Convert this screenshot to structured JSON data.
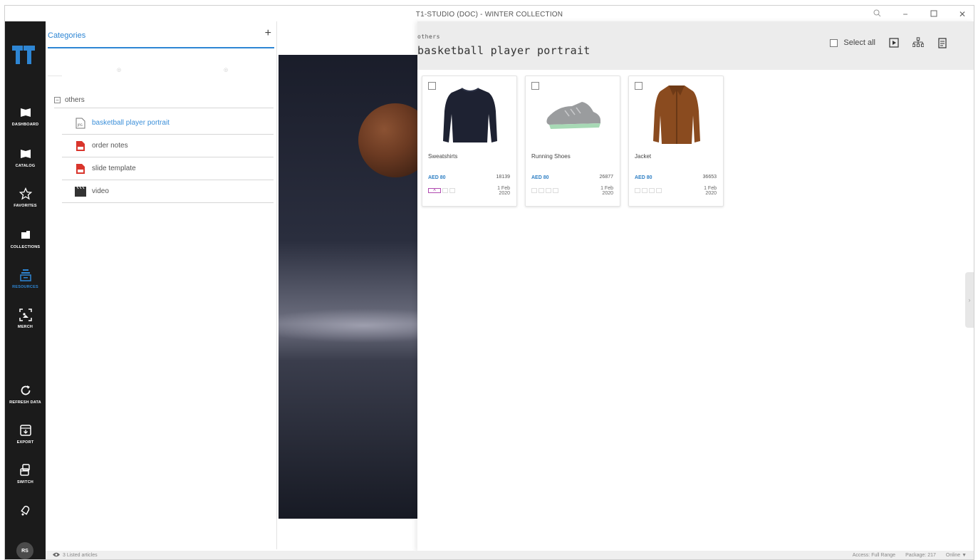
{
  "window": {
    "title": "T1-STUDIO (DOC) - WINTER COLLECTION"
  },
  "nav": {
    "items": [
      {
        "label": "DASHBOARD",
        "icon": "dashboard-icon"
      },
      {
        "label": "CATALOG",
        "icon": "catalog-icon"
      },
      {
        "label": "FAVORITES",
        "icon": "star-icon"
      },
      {
        "label": "COLLECTIONS",
        "icon": "collections-icon"
      },
      {
        "label": "RESOURCES",
        "icon": "resources-icon",
        "active": true
      },
      {
        "label": "MERCH",
        "icon": "merch-icon"
      },
      {
        "label": "REFRESH DATA",
        "icon": "refresh-icon"
      },
      {
        "label": "EXPORT",
        "icon": "export-icon"
      },
      {
        "label": "SWITCH",
        "icon": "switch-icon"
      },
      {
        "label": "",
        "icon": "notification-icon"
      }
    ],
    "avatar": "RS"
  },
  "categories": {
    "title": "Categories",
    "add": "+",
    "tree": {
      "root": "others",
      "items": [
        {
          "label": "basketball player portrait",
          "icon": "jpg-file-icon",
          "selected": true
        },
        {
          "label": "order notes",
          "icon": "pdf-file-icon"
        },
        {
          "label": "slide template",
          "icon": "pdf-file-icon"
        },
        {
          "label": "video",
          "icon": "video-icon"
        }
      ]
    }
  },
  "resource": {
    "breadcrumb": "others",
    "title": "basketball player portrait",
    "select_all": "Select all"
  },
  "articles": [
    {
      "name": "Sweatshirts",
      "price": "AED 80",
      "code": "18139",
      "tag": "A",
      "date_day": "1 Feb",
      "date_year": "2020"
    },
    {
      "name": "Running Shoes",
      "price": "AED 80",
      "code": "26877",
      "tag": "",
      "date_day": "1 Feb",
      "date_year": "2020"
    },
    {
      "name": "Jacket",
      "price": "AED 80",
      "code": "36653",
      "tag": "",
      "date_day": "1 Feb",
      "date_year": "2020"
    }
  ],
  "status": {
    "listed": "3 Listed articles",
    "access": "Access: Full Range",
    "package": "Package: 217",
    "online": "Online"
  },
  "colors": {
    "accent": "#2e86d4",
    "nav_bg": "#1b1b1b",
    "tag": "#b04ab0"
  }
}
